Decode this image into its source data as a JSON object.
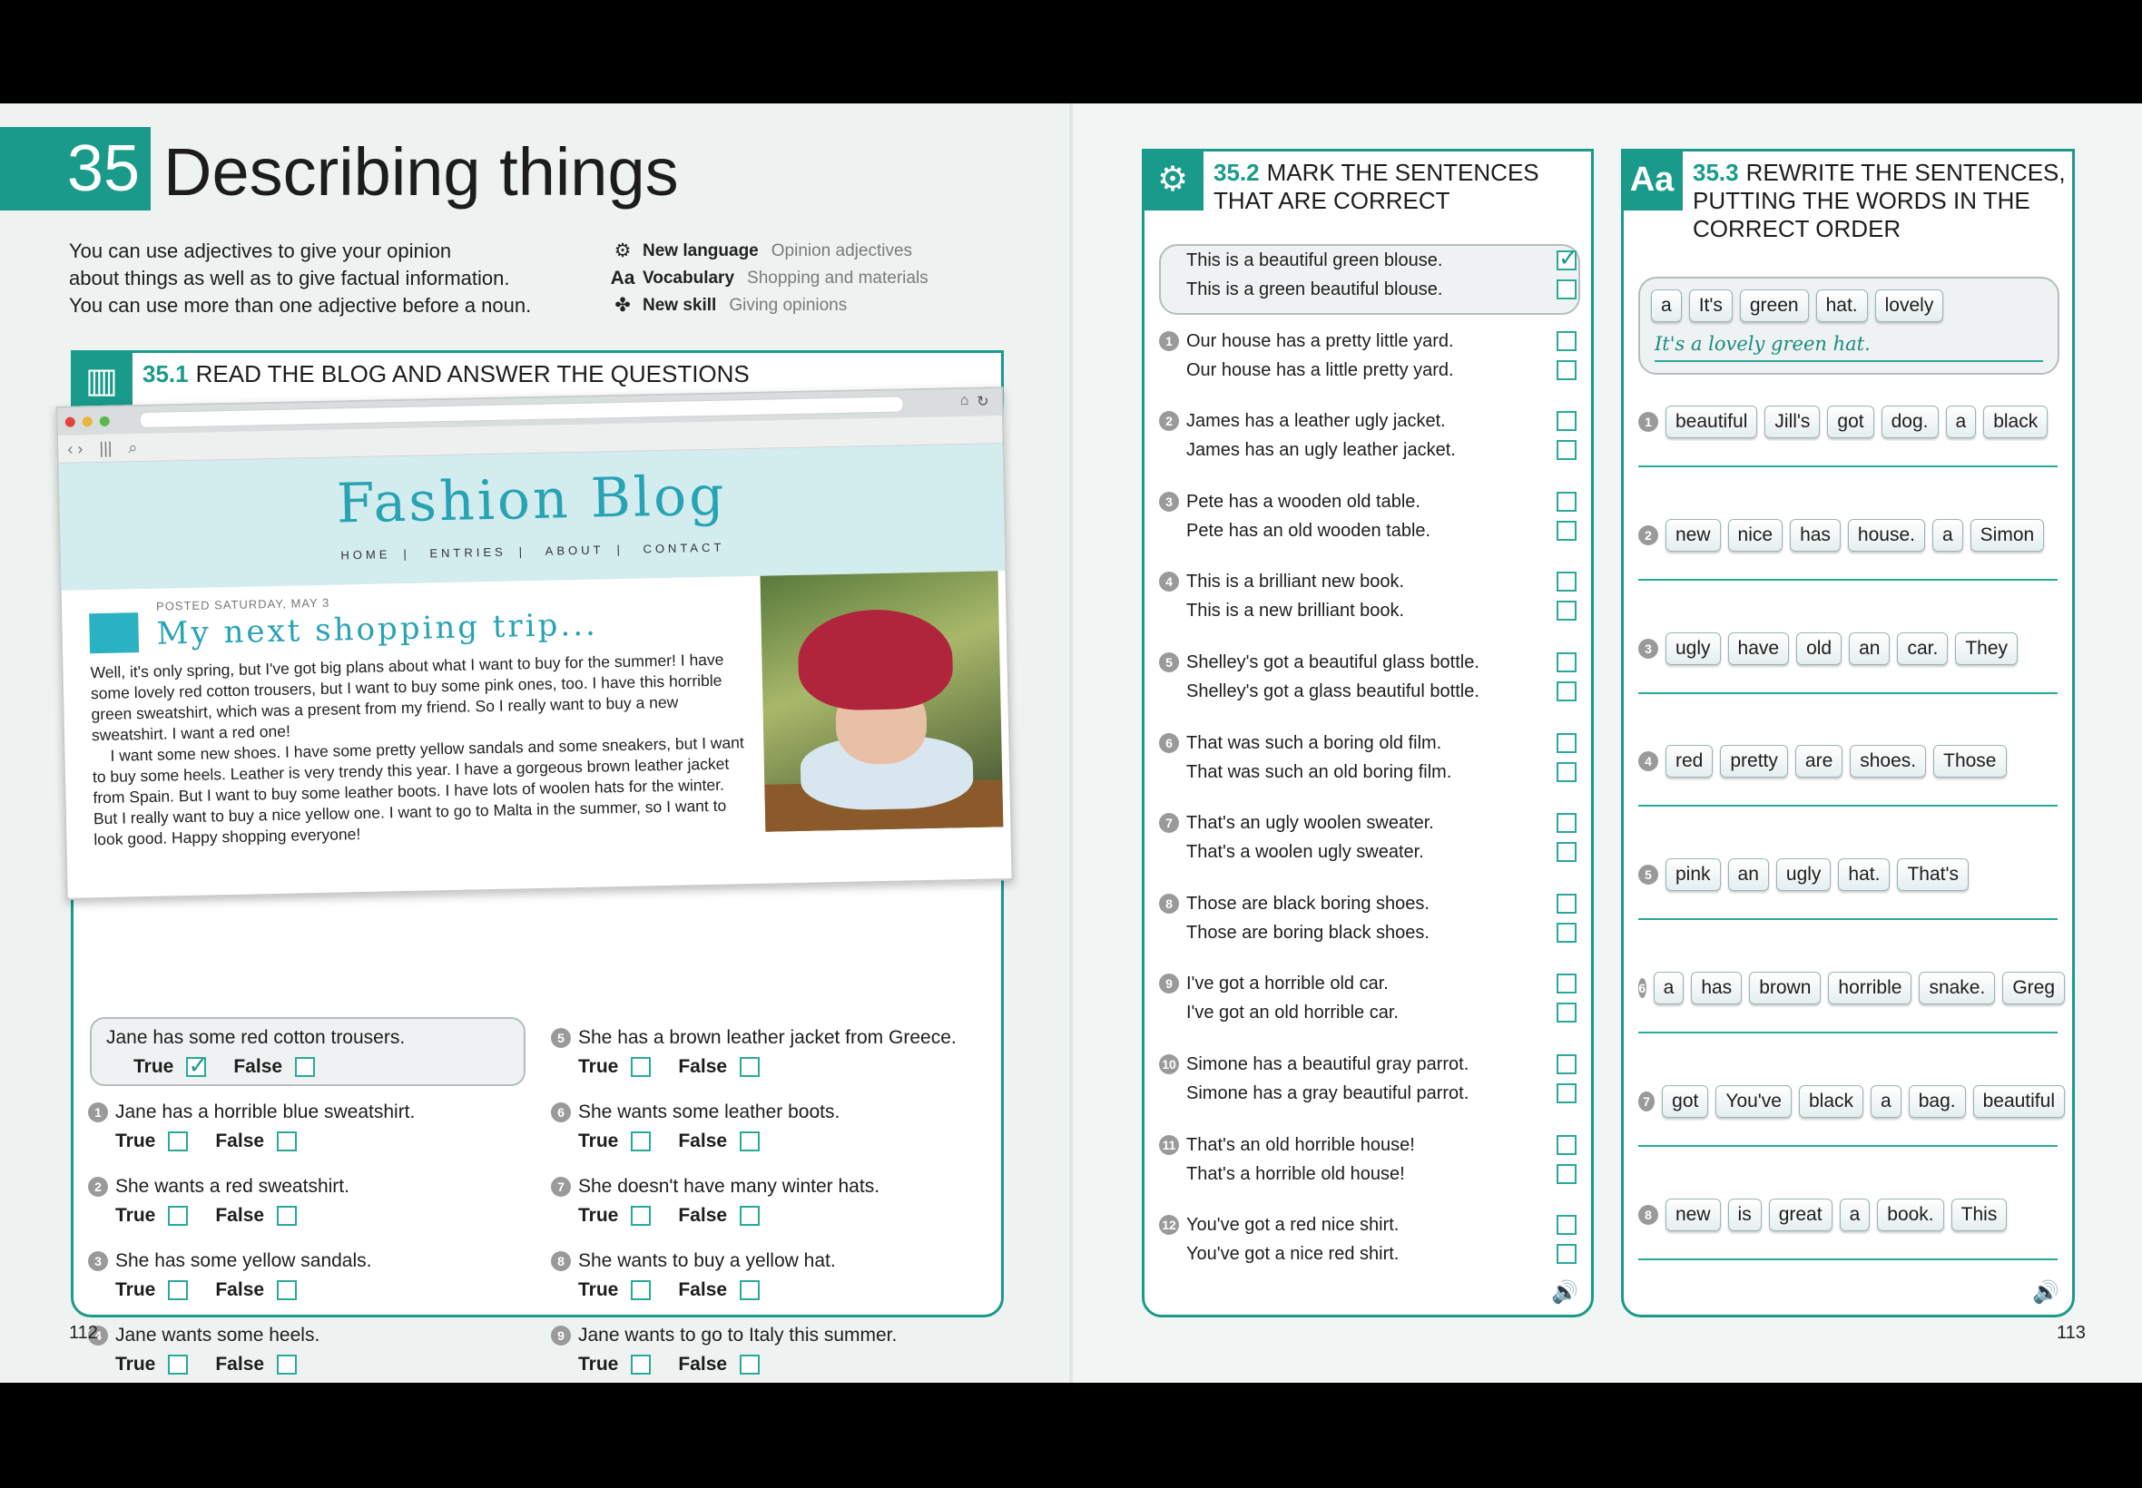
{
  "chapter": {
    "number": "35",
    "title": "Describing things",
    "intro": [
      "You can use adjectives to give your opinion",
      "about things as well as to give factual information.",
      "You can use more than one adjective before a noun."
    ],
    "meta": [
      {
        "icon": "gear-icon",
        "label": "New language",
        "value": "Opinion adjectives"
      },
      {
        "icon": "aa-icon",
        "label": "Vocabulary",
        "value": "Shopping and materials"
      },
      {
        "icon": "puzzle-icon",
        "label": "New skill",
        "value": "Giving opinions"
      }
    ]
  },
  "ex351": {
    "number": "35.1",
    "heading": "READ THE BLOG AND ANSWER THE QUESTIONS",
    "blog": {
      "title": "Fashion Blog",
      "nav": [
        "HOME",
        "ENTRIES",
        "ABOUT",
        "CONTACT"
      ],
      "posted": "POSTED SATURDAY, MAY 3",
      "post_title": "My next shopping trip...",
      "paragraphs": [
        "Well, it's only spring, but I've got big plans about what I want to buy for the summer! I have some lovely red cotton trousers, but I want to buy some pink ones, too. I have this horrible green sweatshirt, which was a present from my friend. So I really want to buy a new sweatshirt. I want a red one!",
        "I want some new shoes. I have some pretty yellow sandals and some sneakers, but I want to buy some heels. Leather is very trendy this year. I have a gorgeous brown leather jacket from Spain. But I want to buy some leather boots. I have lots of woolen hats for the winter. But I really want to buy a nice yellow one. I want to go to Malta in the summer, so I want to look good. Happy shopping everyone!"
      ]
    },
    "true_label": "True",
    "false_label": "False",
    "questions": [
      {
        "n": "",
        "text": "Jane has some red cotton trousers."
      },
      {
        "n": "1",
        "text": "Jane has a horrible blue sweatshirt."
      },
      {
        "n": "2",
        "text": "She wants a red sweatshirt."
      },
      {
        "n": "3",
        "text": "She has some yellow sandals."
      },
      {
        "n": "4",
        "text": "Jane wants some heels."
      },
      {
        "n": "5",
        "text": "She has a brown leather jacket from Greece."
      },
      {
        "n": "6",
        "text": "She wants some leather boots."
      },
      {
        "n": "7",
        "text": "She doesn't have many winter hats."
      },
      {
        "n": "8",
        "text": "She wants to buy a yellow hat."
      },
      {
        "n": "9",
        "text": "Jane wants to go to Italy this summer."
      }
    ]
  },
  "ex352": {
    "number": "35.2",
    "heading_line1": "MARK THE SENTENCES",
    "heading_line2": "THAT ARE CORRECT",
    "pairs": [
      {
        "n": "",
        "a": "This is a beautiful green blouse.",
        "b": "This is a green beautiful blouse."
      },
      {
        "n": "1",
        "a": "Our house has a pretty little yard.",
        "b": "Our house has a little pretty yard."
      },
      {
        "n": "2",
        "a": "James has a leather ugly jacket.",
        "b": "James has an ugly leather jacket."
      },
      {
        "n": "3",
        "a": "Pete has a wooden old table.",
        "b": "Pete has an old wooden table."
      },
      {
        "n": "4",
        "a": "This is a brilliant new book.",
        "b": "This is a new brilliant book."
      },
      {
        "n": "5",
        "a": "Shelley's got a beautiful glass bottle.",
        "b": "Shelley's got a glass beautiful bottle."
      },
      {
        "n": "6",
        "a": "That was such a boring old film.",
        "b": "That was such an old boring film."
      },
      {
        "n": "7",
        "a": "That's an ugly woolen sweater.",
        "b": "That's a woolen ugly sweater."
      },
      {
        "n": "8",
        "a": "Those are black boring shoes.",
        "b": "Those are boring black shoes."
      },
      {
        "n": "9",
        "a": "I've got a horrible old car.",
        "b": "I've got an old horrible car."
      },
      {
        "n": "10",
        "a": "Simone has a beautiful gray parrot.",
        "b": "Simone has a gray beautiful parrot."
      },
      {
        "n": "11",
        "a": "That's an old horrible house!",
        "b": "That's a horrible old house!"
      },
      {
        "n": "12",
        "a": "You've got a red nice shirt.",
        "b": "You've got a nice red shirt."
      }
    ]
  },
  "ex353": {
    "number": "35.3",
    "heading_lines": [
      "REWRITE THE SENTENCES,",
      "PUTTING THE WORDS IN THE",
      "CORRECT ORDER"
    ],
    "example_tiles": [
      "a",
      "It's",
      "green",
      "hat.",
      "lovely"
    ],
    "example_answer": "It's a lovely green hat.",
    "items": [
      {
        "n": "1",
        "tiles": [
          "beautiful",
          "Jill's",
          "got",
          "dog.",
          "a",
          "black"
        ]
      },
      {
        "n": "2",
        "tiles": [
          "new",
          "nice",
          "has",
          "house.",
          "a",
          "Simon"
        ]
      },
      {
        "n": "3",
        "tiles": [
          "ugly",
          "have",
          "old",
          "an",
          "car.",
          "They"
        ]
      },
      {
        "n": "4",
        "tiles": [
          "red",
          "pretty",
          "are",
          "shoes.",
          "Those"
        ]
      },
      {
        "n": "5",
        "tiles": [
          "pink",
          "an",
          "ugly",
          "hat.",
          "That's"
        ]
      },
      {
        "n": "6",
        "tiles": [
          "a",
          "has",
          "brown",
          "horrible",
          "snake.",
          "Greg"
        ]
      },
      {
        "n": "7",
        "tiles": [
          "got",
          "You've",
          "black",
          "a",
          "bag.",
          "beautiful"
        ]
      },
      {
        "n": "8",
        "tiles": [
          "new",
          "is",
          "great",
          "a",
          "book.",
          "This"
        ]
      }
    ]
  },
  "page_numbers": {
    "left": "112",
    "right": "113"
  },
  "colors": {
    "accent": "#1a9a8a",
    "blog": "#27a3b4"
  }
}
